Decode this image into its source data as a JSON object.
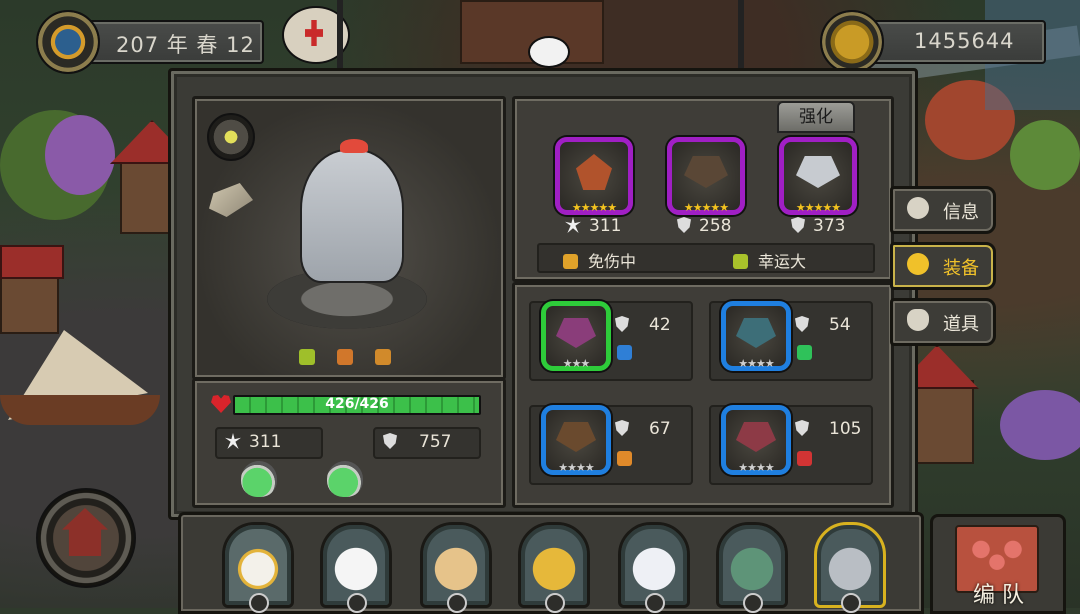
{
  "date_display": "207 年 春 12",
  "gold_amount": "1455644",
  "hero": {
    "hp_text": "426/426",
    "hp_fraction": 1.0,
    "attack": "311",
    "defense": "757"
  },
  "equipped": [
    {
      "stat": "311",
      "icon": "attack-icon",
      "stars": "★★★★★"
    },
    {
      "stat": "258",
      "icon": "shield-icon",
      "stars": "★★★★★"
    },
    {
      "stat": "373",
      "icon": "shield-icon",
      "stars": "★★★★★"
    }
  ],
  "enhance_label": "强化",
  "set_bonuses": [
    "免伤中",
    "幸运大"
  ],
  "inventory": [
    {
      "stat": "42",
      "rarity_color": "#2ecc3a"
    },
    {
      "stat": "54",
      "rarity_color": "#1f7fe0"
    },
    {
      "stat": "67",
      "rarity_color": "#1f7fe0"
    },
    {
      "stat": "105",
      "rarity_color": "#1f7fe0"
    }
  ],
  "side_tabs": [
    {
      "label": "信息",
      "icon": "info-icon"
    },
    {
      "label": "装备",
      "icon": "helmet-icon"
    },
    {
      "label": "道具",
      "icon": "potion-bag-icon"
    }
  ],
  "team_label": "编 队",
  "colors": {
    "accent_gold": "#d8b21f",
    "hp_green": "#3cc04a",
    "purple_epic": "#a01fc4"
  }
}
